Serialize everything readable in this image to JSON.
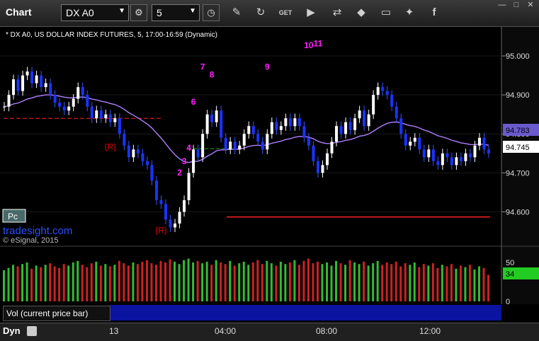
{
  "toolbar": {
    "title": "Chart",
    "symbol": "DX A0",
    "interval": "5",
    "icons": [
      "chart-logo-icon",
      "dropdown-arrow-icon",
      "settings-gear-icon",
      "clock-icon",
      "pencil-draw-icon",
      "refresh-icon",
      "get-data-icon",
      "play-icon",
      "link-icon",
      "comment-icon",
      "twitter-icon",
      "facebook-icon"
    ],
    "window_controls": [
      "minimize-icon",
      "maximize-icon",
      "close-icon"
    ]
  },
  "chart_data": {
    "type": "candlestick",
    "header": "* DX A0, US DOLLAR INDEX FUTURES, 5, 17:00-16:59 (Dynamic)",
    "watermark_brand": "tradesight.com",
    "copyright": "© eSignal, 2015",
    "pc_button": "Pc",
    "price_axis": {
      "ticks": [
        "95.000",
        "94.900",
        "94.800",
        "94.700",
        "94.600"
      ],
      "range": [
        94.53,
        95.06
      ]
    },
    "last_price": "94.745",
    "ma_price": "94.783",
    "x_axis_labels": [
      "13",
      "04:00",
      "08:00",
      "12:00"
    ],
    "series_close": [
      94.87,
      94.9,
      94.94,
      94.91,
      94.95,
      94.96,
      94.93,
      94.95,
      94.92,
      94.93,
      94.9,
      94.88,
      94.87,
      94.86,
      94.87,
      94.89,
      94.92,
      94.9,
      94.87,
      94.84,
      94.86,
      94.84,
      94.85,
      94.83,
      94.84,
      94.8,
      94.77,
      94.74,
      94.76,
      94.75,
      94.73,
      94.72,
      94.68,
      94.63,
      94.62,
      94.58,
      94.56,
      94.57,
      94.6,
      94.63,
      94.7,
      94.76,
      94.74,
      94.8,
      94.85,
      94.83,
      94.86,
      94.79,
      94.76,
      94.78,
      94.76,
      94.77,
      94.8,
      94.82,
      94.8,
      94.78,
      94.76,
      94.8,
      94.83,
      94.81,
      94.82,
      94.84,
      94.82,
      94.84,
      94.82,
      94.79,
      94.77,
      94.73,
      94.7,
      94.72,
      94.75,
      94.78,
      94.82,
      94.8,
      94.83,
      94.81,
      94.84,
      94.86,
      94.82,
      94.85,
      94.9,
      94.92,
      94.91,
      94.9,
      94.87,
      94.84,
      94.8,
      94.77,
      94.78,
      94.79,
      94.76,
      94.74,
      94.76,
      94.73,
      94.72,
      94.75,
      94.74,
      94.72,
      94.74,
      94.73,
      94.75,
      94.74,
      94.77,
      94.79,
      94.76,
      94.75
    ],
    "annotations": [
      {
        "text": "7",
        "color": "#ff22ff",
        "x_index": 43,
        "price": 94.965
      },
      {
        "text": "8",
        "color": "#ff22ff",
        "x_index": 45,
        "price": 94.945
      },
      {
        "text": "6",
        "color": "#ff22ff",
        "x_index": 41,
        "price": 94.875
      },
      {
        "text": "4",
        "color": "#ff22ff",
        "x_index": 40,
        "price": 94.757
      },
      {
        "text": "3",
        "color": "#ff22ff",
        "x_index": 39,
        "price": 94.722
      },
      {
        "text": "2",
        "color": "#ff22ff",
        "x_index": 38,
        "price": 94.693
      },
      {
        "text": "9",
        "color": "#ff22ff",
        "x_index": 57,
        "price": 94.965
      },
      {
        "text": "10",
        "color": "#ff22ff",
        "x_index": 66,
        "price": 95.02
      },
      {
        "text": "11",
        "color": "#ff22ff",
        "x_index": 68,
        "price": 95.025
      },
      {
        "text": "(R)",
        "color": "#a00000",
        "x_index": 23,
        "price": 94.76
      },
      {
        "text": "(R)",
        "color": "#a00000",
        "x_index": 34,
        "price": 94.545
      }
    ],
    "volume": {
      "ticks": [
        "50",
        "0"
      ],
      "last": "34",
      "label": "Vol (current price bar)",
      "values": [
        40,
        43,
        47,
        45,
        48,
        50,
        42,
        46,
        44,
        47,
        49,
        45,
        43,
        48,
        46,
        50,
        52,
        47,
        44,
        49,
        51,
        46,
        48,
        45,
        47,
        52,
        49,
        46,
        50,
        48,
        51,
        53,
        49,
        47,
        52,
        50,
        54,
        51,
        48,
        53,
        55,
        50,
        52,
        49,
        51,
        47,
        53,
        50,
        48,
        52,
        46,
        49,
        51,
        47,
        50,
        53,
        48,
        52,
        49,
        46,
        51,
        48,
        50,
        53,
        47,
        52,
        55,
        49,
        51,
        48,
        50,
        46,
        52,
        49,
        47,
        53,
        50,
        48,
        51,
        46,
        49,
        52,
        47,
        50,
        48,
        51,
        45,
        49,
        47,
        50,
        44,
        48,
        46,
        49,
        43,
        47,
        45,
        48,
        42,
        46,
        44,
        47,
        41,
        45,
        43,
        34
      ]
    },
    "bottom_label": "Dyn"
  }
}
